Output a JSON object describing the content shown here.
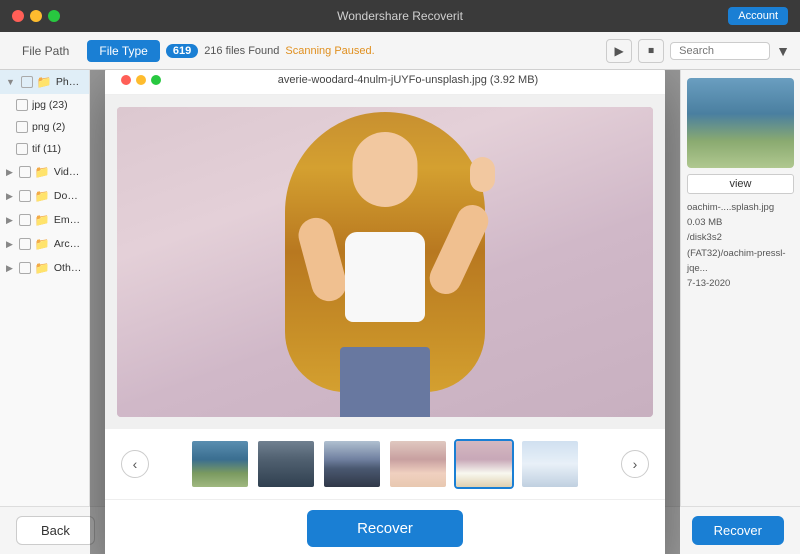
{
  "titleBar": {
    "title": "Wondershare Recoverit",
    "accountLabel": "Account"
  },
  "toolbar": {
    "filePathTab": "File Path",
    "fileTypeTab": "File Type",
    "badgeCount": "619",
    "filesFound": "216 files Found",
    "scanStatus": "Scanning Paused.",
    "searchPlaceholder": "Search"
  },
  "sidebar": {
    "items": [
      {
        "label": "Photo",
        "hasArrow": true,
        "expanded": true,
        "hasCheckbox": true
      },
      {
        "label": "jpg (23)",
        "isChild": true,
        "hasCheckbox": true
      },
      {
        "label": "png (2)",
        "isChild": true,
        "hasCheckbox": true
      },
      {
        "label": "tif (11)",
        "isChild": true,
        "hasCheckbox": true
      },
      {
        "label": "Video (",
        "hasArrow": true,
        "hasCheckbox": true
      },
      {
        "label": "Docum",
        "hasArrow": true,
        "hasCheckbox": true
      },
      {
        "label": "Email (",
        "hasArrow": true,
        "hasCheckbox": true
      },
      {
        "label": "Archiv",
        "hasArrow": true,
        "hasCheckbox": true
      },
      {
        "label": "Others",
        "hasArrow": true,
        "hasCheckbox": true
      }
    ]
  },
  "rightPanel": {
    "previewLabel": "view",
    "filename": "oachim-....splash.jpg",
    "filesize": "0.03 MB",
    "location": "/disk3s2 (FAT32)/oachim-pressl-jqe...",
    "date": "7-13-2020"
  },
  "modal": {
    "filename": "averie-woodard-4nulm-jUYFo-unsplash.jpg (3.92 MB)",
    "recoverLabel": "Recover",
    "thumbnails": [
      {
        "type": "lake",
        "selected": false
      },
      {
        "type": "mountain",
        "selected": false
      },
      {
        "type": "city",
        "selected": false
      },
      {
        "type": "person",
        "selected": false
      },
      {
        "type": "woman-pink",
        "selected": true
      },
      {
        "type": "drone",
        "selected": false
      }
    ]
  },
  "bottomBar": {
    "backLabel": "Back",
    "recoverLabel": "Recover"
  },
  "colors": {
    "accent": "#1a7fd4",
    "scanStatus": "#e09020"
  }
}
